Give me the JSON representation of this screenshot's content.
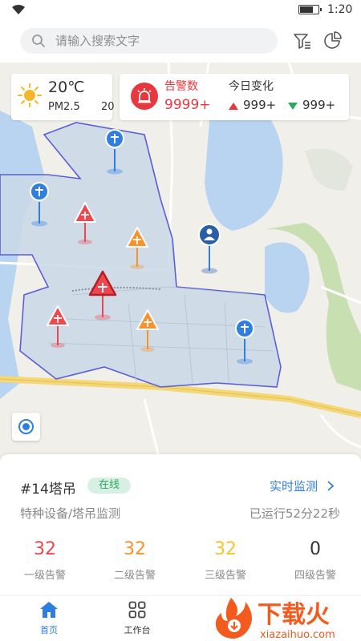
{
  "status_bar": {
    "time": "1:20",
    "battery_level": 0.75,
    "icons": [
      "wifi-icon",
      "battery-icon"
    ]
  },
  "search": {
    "placeholder": "请输入搜索文字",
    "icon": "search-icon"
  },
  "header_actions": {
    "filter_icon": "filter-icon",
    "stats_icon": "pie-chart-icon"
  },
  "weather": {
    "temperature": "20℃",
    "pm_label": "PM2.5",
    "pm_value": "20",
    "icon": "sun-icon"
  },
  "alarm_summary": {
    "label": "告警数",
    "count": "9999+",
    "change_label": "今日变化",
    "increase": "999+",
    "decrease": "999+",
    "icon": "alarm-siren-icon"
  },
  "map": {
    "zone_color": "#c9d8e8",
    "zone_border": "#5b5fd6",
    "markers": [
      {
        "kind": "tower-crane",
        "status": "normal",
        "icon": "crane-pin-icon"
      },
      {
        "kind": "tower-crane",
        "status": "normal",
        "icon": "crane-pin-icon"
      },
      {
        "kind": "tower-crane",
        "status": "alarm-level-1",
        "icon": "crane-warning-icon"
      },
      {
        "kind": "tower-crane",
        "status": "alarm-level-2",
        "icon": "crane-warning-icon"
      },
      {
        "kind": "tower-crane",
        "status": "alarm-level-1-selected",
        "icon": "crane-warning-icon"
      },
      {
        "kind": "tower-crane",
        "status": "alarm-level-1",
        "icon": "crane-warning-icon"
      },
      {
        "kind": "tower-crane",
        "status": "alarm-level-2",
        "icon": "crane-warning-icon"
      },
      {
        "kind": "tower-crane",
        "status": "normal",
        "icon": "crane-pin-icon"
      },
      {
        "kind": "person",
        "status": "normal",
        "icon": "user-pin-icon"
      }
    ],
    "locate_icon": "locate-icon"
  },
  "device": {
    "title": "#14塔吊",
    "status": "在线",
    "realtime_link": "实时监测",
    "category": "特种设备/塔吊监测",
    "runtime": "已运行52分22秒"
  },
  "levels": [
    {
      "value": "32",
      "label": "一级告警",
      "color": "#f0464d"
    },
    {
      "value": "32",
      "label": "二级告警",
      "color": "#f7922c"
    },
    {
      "value": "32",
      "label": "三级告警",
      "color": "#f6c331"
    },
    {
      "value": "0",
      "label": "四级告警",
      "color": "#333333"
    }
  ],
  "tabs": [
    {
      "label": "首页",
      "icon": "home-icon",
      "active": true
    },
    {
      "label": "工作台",
      "icon": "workbench-grid-icon",
      "active": false
    }
  ],
  "watermark": {
    "text": "下载火",
    "url_text": "xiazaihuo.com"
  },
  "colors": {
    "accent": "#2f7fe0",
    "alarm": "#e8373d",
    "online": "#2ba860"
  }
}
